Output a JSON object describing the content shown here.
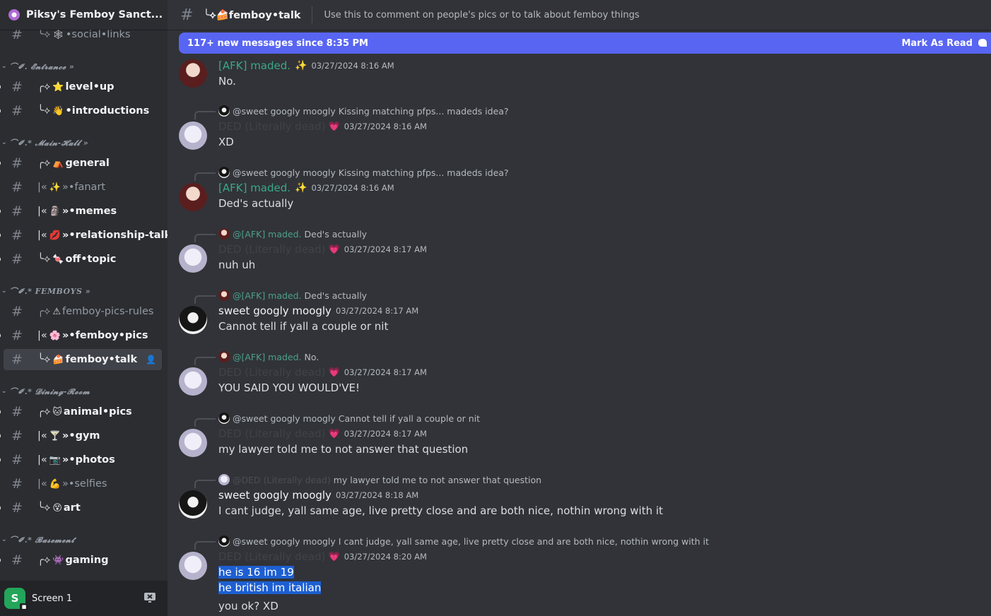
{
  "server": {
    "name": "Piksy's Femboy Sanct..."
  },
  "channels": [
    {
      "prefix": "╰⟡",
      "emoji": "🕸",
      "name": "•social•links",
      "state": "read",
      "partial": true
    },
    {
      "category": "⌒✐. 𝓔𝓷𝓽𝓻𝓪𝓷𝓬𝓮 »"
    },
    {
      "prefix": "╭⟡",
      "emoji": "⭐",
      "name": "level•up",
      "state": "unread"
    },
    {
      "prefix": "╰⟡",
      "emoji": "👋",
      "name": "•introductions",
      "state": "unread"
    },
    {
      "category": "⌒✐.* 𝓜𝓪𝓲𝓷-𝓗𝓪𝓵𝓵 »"
    },
    {
      "prefix": "╭⟡",
      "emoji": "⛺",
      "name": "general",
      "state": "unread"
    },
    {
      "prefix": "|«",
      "emoji": "✨",
      "name": "»•fanart",
      "state": "read"
    },
    {
      "prefix": "|«",
      "emoji": "🗿",
      "name": "»•memes",
      "state": "unread"
    },
    {
      "prefix": "|«",
      "emoji": "💋",
      "name": "»•relationship-talk",
      "state": "unread"
    },
    {
      "prefix": "╰⟡",
      "emoji": "🍬",
      "name": "off•topic",
      "state": "unread"
    },
    {
      "category": "⌒✐.* FEMBOYS »"
    },
    {
      "prefix": "╭⟡",
      "emoji": "⚠",
      "name": "femboy-pics-rules",
      "state": "read"
    },
    {
      "prefix": "|«",
      "emoji": "🌸",
      "name": "»•femboy•pics",
      "state": "unread"
    },
    {
      "prefix": "╰⟡",
      "emoji": "🍰",
      "name": "femboy•talk",
      "state": "active"
    },
    {
      "category": "⌒✐.* 𝓓𝓲𝓷𝓲𝓷𝓰-𝓡𝓸𝓸𝓶"
    },
    {
      "prefix": "╭⟡",
      "emoji": "🐱",
      "name": "animal•pics",
      "state": "unread"
    },
    {
      "prefix": "|«",
      "emoji": "🍸",
      "name": "»•gym",
      "state": "unread"
    },
    {
      "prefix": "|«",
      "emoji": "📷",
      "name": "»•photos",
      "state": "unread"
    },
    {
      "prefix": "|«",
      "emoji": "💪",
      "name": "»•selfies",
      "state": "read"
    },
    {
      "prefix": "╰⟡",
      "emoji": "😵",
      "name": "art",
      "state": "unread"
    },
    {
      "category": "⌒✐.* 𝓑𝓪𝓼𝓮𝓶𝓮𝓷𝓽"
    },
    {
      "prefix": "╭⟡",
      "emoji": "👾",
      "name": "gaming",
      "state": "unread"
    }
  ],
  "voice": {
    "avatar_letter": "S",
    "label": "Screen 1"
  },
  "topbar": {
    "channel": "╰⟡🍰femboy•talk",
    "topic": "Use this to comment on people's pics or to talk about femboy things"
  },
  "banner": {
    "text": "117+ new messages since 8:35 PM",
    "mark_read": "Mark As Read"
  },
  "messages": [
    {
      "reply": null,
      "author": "[AFK] maded.",
      "author_style": "teal",
      "avatar": "afk",
      "badge": "✨",
      "timestamp": "03/27/2024 8:16 AM",
      "lines": [
        "No."
      ]
    },
    {
      "reply": {
        "avatar": "sweet",
        "user": "@sweet googly moogly",
        "user_style": "gray",
        "text": "Kissing matching pfps... madeds idea?"
      },
      "author": "DED (Literally dead)",
      "author_style": "faint",
      "avatar": "ded",
      "badge": "💗",
      "timestamp": "03/27/2024 8:16 AM",
      "lines": [
        "XD"
      ]
    },
    {
      "reply": {
        "avatar": "sweet",
        "user": "@sweet googly moogly",
        "user_style": "gray",
        "text": "Kissing matching pfps... madeds idea?"
      },
      "author": "[AFK] maded.",
      "author_style": "teal",
      "avatar": "afk",
      "badge": "✨",
      "timestamp": "03/27/2024 8:16 AM",
      "lines": [
        "Ded's actually"
      ]
    },
    {
      "reply": {
        "avatar": "afk",
        "user": "@[AFK] maded.",
        "user_style": "teal",
        "text": "Ded's actually"
      },
      "author": "DED (Literally dead)",
      "author_style": "faint",
      "avatar": "ded",
      "badge": "💗",
      "timestamp": "03/27/2024 8:17 AM",
      "lines": [
        "nuh uh"
      ]
    },
    {
      "reply": {
        "avatar": "afk",
        "user": "@[AFK] maded.",
        "user_style": "teal",
        "text": "Ded's actually"
      },
      "author": "sweet googly moogly",
      "author_style": "white",
      "avatar": "sweet",
      "badge": "",
      "timestamp": "03/27/2024 8:17 AM",
      "lines": [
        "Cannot tell if yall a couple or nit"
      ]
    },
    {
      "reply": {
        "avatar": "afk",
        "user": "@[AFK] maded.",
        "user_style": "teal",
        "text": "No."
      },
      "author": "DED (Literally dead)",
      "author_style": "faint",
      "avatar": "ded",
      "badge": "💗",
      "timestamp": "03/27/2024 8:17 AM",
      "lines": [
        "YOU SAID YOU WOULD'VE!"
      ]
    },
    {
      "reply": {
        "avatar": "sweet",
        "user": "@sweet googly moogly",
        "user_style": "gray",
        "text": "Cannot tell if yall a couple or nit"
      },
      "author": "DED (Literally dead)",
      "author_style": "faint",
      "avatar": "ded",
      "badge": "💗",
      "timestamp": "03/27/2024 8:17 AM",
      "lines": [
        "my lawyer told me to not answer that question"
      ]
    },
    {
      "reply": {
        "avatar": "ded",
        "user": "@DED (Literally dead)",
        "user_style": "faint",
        "text": "my lawyer told me to not answer that question"
      },
      "author": "sweet googly moogly",
      "author_style": "white",
      "avatar": "sweet",
      "badge": "",
      "timestamp": "03/27/2024 8:18 AM",
      "lines": [
        "I cant judge, yall same age, live pretty close and are both nice, nothin wrong with it"
      ]
    },
    {
      "reply": {
        "avatar": "sweet",
        "user": "@sweet googly moogly",
        "user_style": "gray",
        "text": "I cant judge, yall same age, live pretty close and are both nice, nothin wrong with it"
      },
      "author": "DED (Literally dead)",
      "author_style": "faint",
      "avatar": "ded",
      "badge": "💗",
      "timestamp": "03/27/2024 8:20 AM",
      "lines": [
        "he is 16 im 19",
        "he british im italian",
        "you ok? XD"
      ],
      "selected_lines": [
        0,
        1
      ]
    }
  ]
}
